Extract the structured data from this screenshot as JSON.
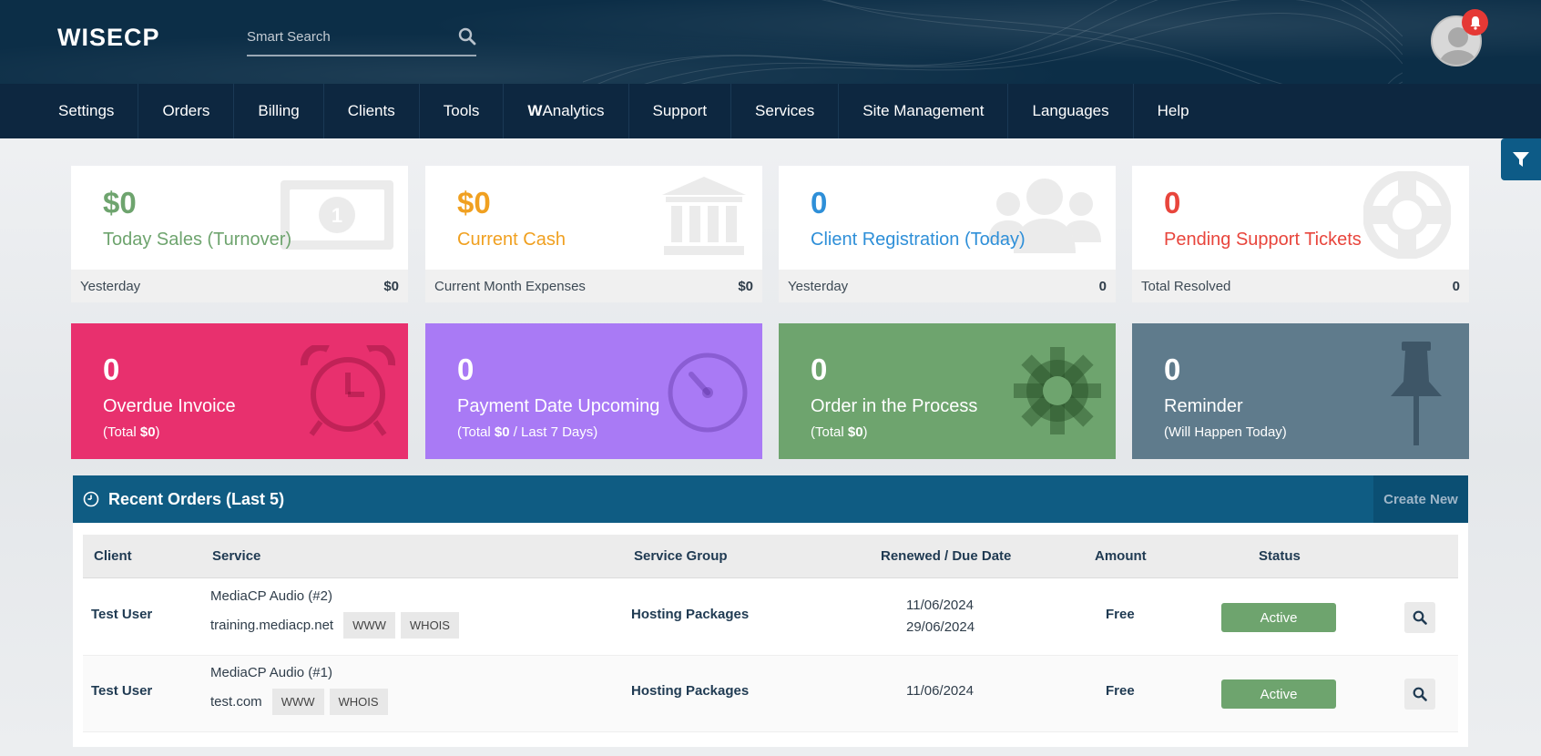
{
  "header": {
    "logo_text": "WISECP",
    "search_placeholder": "Smart Search"
  },
  "nav": [
    {
      "label": "Settings"
    },
    {
      "label": "Orders"
    },
    {
      "label": "Billing"
    },
    {
      "label": "Clients"
    },
    {
      "label": "Tools"
    },
    {
      "prefix": "W",
      "label": "Analytics"
    },
    {
      "label": "Support"
    },
    {
      "label": "Services"
    },
    {
      "label": "Site Management"
    },
    {
      "label": "Languages"
    },
    {
      "label": "Help"
    }
  ],
  "stats": [
    {
      "value": "$0",
      "label": "Today Sales (Turnover)",
      "foot_label": "Yesterday",
      "foot_value": "$0",
      "color": "#6ea46e",
      "icon": "money-bill-icon"
    },
    {
      "value": "$0",
      "label": "Current Cash",
      "foot_label": "Current Month Expenses",
      "foot_value": "$0",
      "color": "#f0a020",
      "icon": "bank-icon"
    },
    {
      "value": "0",
      "label": "Client Registration (Today)",
      "foot_label": "Yesterday",
      "foot_value": "0",
      "color": "#2e8fd8",
      "icon": "users-icon"
    },
    {
      "value": "0",
      "label": "Pending Support Tickets",
      "foot_label": "Total Resolved",
      "foot_value": "0",
      "color": "#e8453c",
      "icon": "life-ring-icon"
    }
  ],
  "colored_stats": [
    {
      "value": "0",
      "label": "Overdue Invoice",
      "sub_pre": "(Total ",
      "sub_bold": "$0",
      "sub_post": ")",
      "color": "#e8306e",
      "icon": "alarm-clock-icon"
    },
    {
      "value": "0",
      "label": "Payment Date Upcoming",
      "sub_pre": "(Total ",
      "sub_bold": "$0",
      "sub_post": " / Last 7 Days)",
      "color": "#a97af5",
      "icon": "timer-icon"
    },
    {
      "value": "0",
      "label": "Order in the Process",
      "sub_pre": "(Total ",
      "sub_bold": "$0",
      "sub_post": ")",
      "color": "#6ea46e",
      "icon": "gear-icon"
    },
    {
      "value": "0",
      "label": "Reminder",
      "sub_pre": "(Will Happen Today)",
      "sub_bold": "",
      "sub_post": "",
      "color": "#5f7b8c",
      "icon": "thumbtack-icon"
    }
  ],
  "orders": {
    "title": "Recent Orders (Last 5)",
    "create_new": "Create New",
    "columns": [
      "Client",
      "Service",
      "Service Group",
      "Renewed / Due Date",
      "Amount",
      "Status"
    ],
    "rows": [
      {
        "client": "Test User",
        "service": "MediaCP Audio (#2)",
        "domain": "training.mediacp.net",
        "www": "WWW",
        "whois": "WHOIS",
        "group": "Hosting Packages",
        "renewed": "11/06/2024",
        "due": "29/06/2024",
        "amount": "Free",
        "status": "Active"
      },
      {
        "client": "Test User",
        "service": "MediaCP Audio (#1)",
        "domain": "test.com",
        "www": "WWW",
        "whois": "WHOIS",
        "group": "Hosting Packages",
        "renewed": "11/06/2024",
        "due": "",
        "amount": "Free",
        "status": "Active"
      }
    ]
  }
}
